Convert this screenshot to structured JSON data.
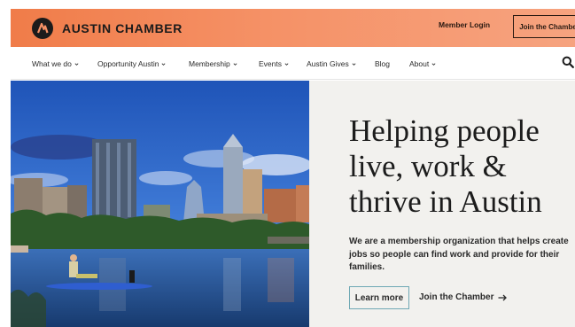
{
  "header": {
    "brand": "AUSTIN CHAMBER",
    "member_login": "Member Login",
    "join_button": "Join the Chamber"
  },
  "nav": {
    "items": [
      {
        "label": "What we do",
        "dropdown": true
      },
      {
        "label": "Opportunity Austin",
        "dropdown": true
      },
      {
        "label": "Membership",
        "dropdown": true
      },
      {
        "label": "Events",
        "dropdown": true
      },
      {
        "label": "Austin Gives",
        "dropdown": true
      },
      {
        "label": "Blog",
        "dropdown": false
      },
      {
        "label": "About",
        "dropdown": true
      }
    ],
    "search_icon": "search-icon"
  },
  "hero": {
    "headline": [
      "Helping people",
      "live, work &",
      "thrive in Austin"
    ],
    "description": "We are a membership organization that helps create jobs so people can find work and provide for their families.",
    "cta_primary": "Learn more",
    "cta_secondary": "Join the Chamber",
    "cta_secondary_icon": "arrow-right-icon",
    "image": "austin-skyline-paddleboarder"
  },
  "colors": {
    "topbar_start": "#f07c49",
    "topbar_end": "#f6a37f",
    "panel_bg": "#f2f1ee",
    "button_border": "#6fa8b4",
    "text_dark": "#1c1c1c"
  }
}
